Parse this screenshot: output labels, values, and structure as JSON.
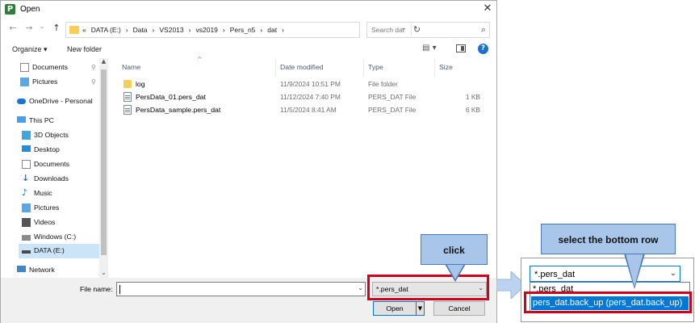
{
  "window": {
    "title": "Open",
    "close_glyph": "✕",
    "app_letter": "P"
  },
  "nav": {
    "back_glyph": "←",
    "forward_glyph": "→",
    "recent_glyph": "⌄",
    "up_glyph": "↑",
    "breadcrumb": [
      "«",
      "DATA (E:)",
      "›",
      "Data",
      "›",
      "VS2013",
      "›",
      "vs2019",
      "›",
      "Pers_n5",
      "›",
      "dat",
      "›"
    ],
    "search_placeholder": "Search dat"
  },
  "toolbar": {
    "organize_label": "Organize ▾",
    "new_folder_label": "New folder",
    "help_glyph": "?",
    "view_glyph": "▤ ▾"
  },
  "sidebar": {
    "items": [
      {
        "label": "Documents",
        "icon": "documents-icon",
        "pinned": true
      },
      {
        "label": "Pictures",
        "icon": "pictures-icon",
        "pinned": true
      },
      {
        "label": "OneDrive - Personal",
        "icon": "onedrive-icon"
      },
      {
        "label": "This PC",
        "icon": "pc-icon"
      },
      {
        "label": "3D Objects",
        "icon": "3d-objects-icon"
      },
      {
        "label": "Desktop",
        "icon": "desktop-icon"
      },
      {
        "label": "Documents",
        "icon": "documents-icon"
      },
      {
        "label": "Downloads",
        "icon": "downloads-icon"
      },
      {
        "label": "Music",
        "icon": "music-icon"
      },
      {
        "label": "Pictures",
        "icon": "pictures-icon"
      },
      {
        "label": "Videos",
        "icon": "videos-icon"
      },
      {
        "label": "Windows (C:)",
        "icon": "drive-icon"
      },
      {
        "label": "DATA (E:)",
        "icon": "drive-icon",
        "selected": true
      },
      {
        "label": "Network",
        "icon": "network-icon"
      }
    ],
    "pin_glyph": "📌"
  },
  "filelist": {
    "columns": {
      "name": "Name",
      "date": "Date modified",
      "type": "Type",
      "size": "Size"
    },
    "rows": [
      {
        "name": "log",
        "date": "11/9/2024 10:51 PM",
        "type": "File folder",
        "size": "",
        "kind": "folder"
      },
      {
        "name": "PersData_01.pers_dat",
        "date": "11/12/2024 7:40 PM",
        "type": "PERS_DAT File",
        "size": "1 KB",
        "kind": "file"
      },
      {
        "name": "PersData_sample.pers_dat",
        "date": "11/5/2024 8:41 AM",
        "type": "PERS_DAT File",
        "size": "6 KB",
        "kind": "file"
      }
    ]
  },
  "bottom": {
    "filename_label": "File name:",
    "filename_value": "",
    "filetype_value": "*.pers_dat",
    "open_label": "Open",
    "cancel_label": "Cancel"
  },
  "callouts": {
    "click": "click",
    "select": "select the bottom row"
  },
  "zoom": {
    "select_value": "*.pers_dat",
    "options": [
      "*.pers_dat",
      "pers_dat.back_up (pers_dat.back_up)"
    ]
  },
  "colors": {
    "accent": "#0078d7",
    "highlight_red": "#d0021b",
    "callout_fill": "#a8c6ea"
  }
}
